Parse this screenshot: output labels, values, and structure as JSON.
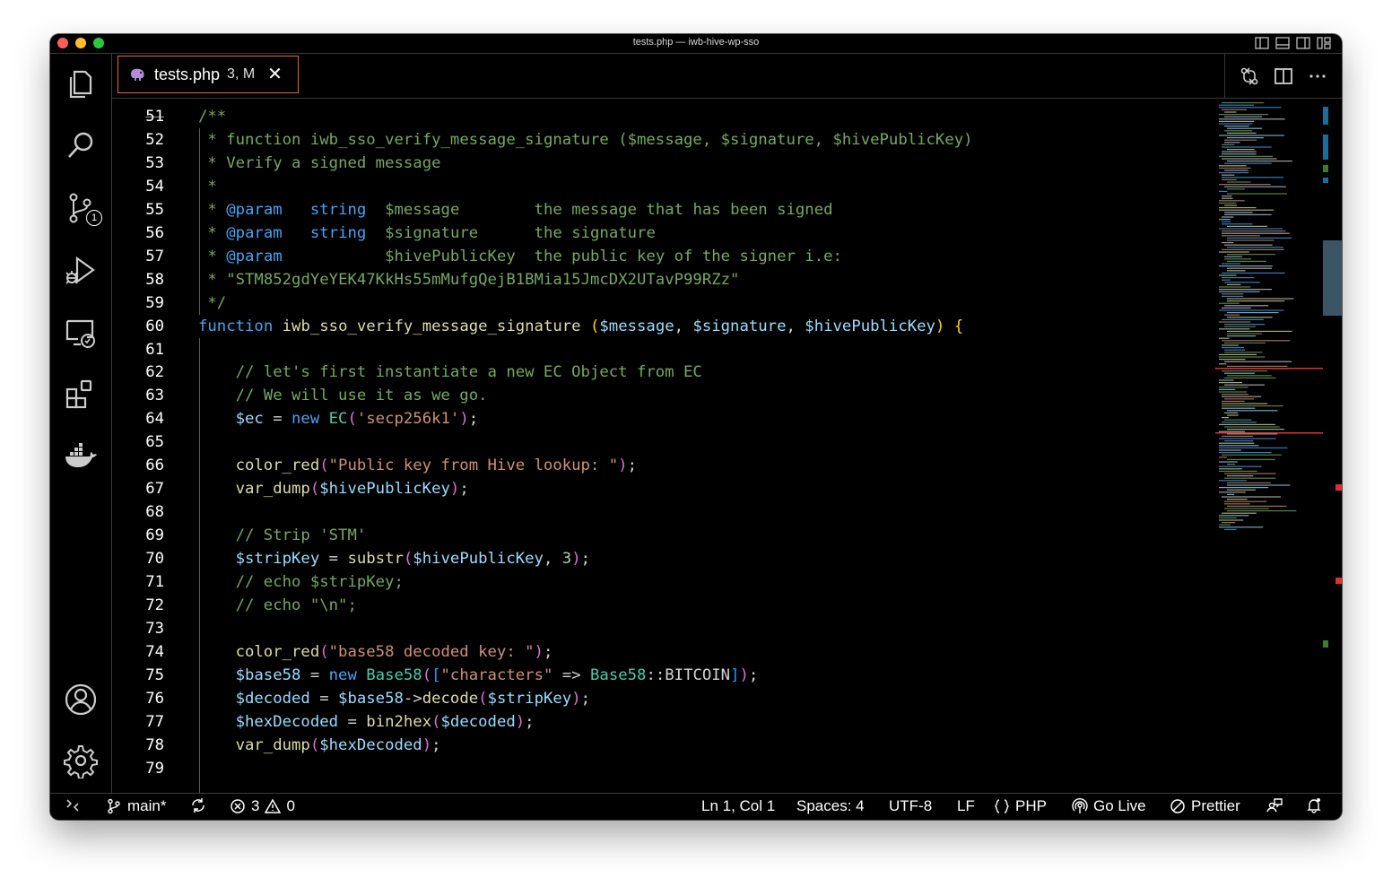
{
  "window": {
    "title": "tests.php — iwb-hive-wp-sso",
    "traffic_lights": [
      "#ff5f57",
      "#febc2e",
      "#28c840"
    ]
  },
  "activity_bar": {
    "items": [
      {
        "name": "explorer-icon"
      },
      {
        "name": "search-icon"
      },
      {
        "name": "source-control-icon",
        "badge": "1"
      },
      {
        "name": "run-debug-icon"
      },
      {
        "name": "remote-explorer-icon"
      },
      {
        "name": "extensions-icon"
      },
      {
        "name": "docker-icon"
      }
    ],
    "bottom": [
      {
        "name": "account-icon"
      },
      {
        "name": "settings-gear-icon"
      }
    ]
  },
  "tabs": [
    {
      "name": "tests.php",
      "status": "3, M",
      "active": true,
      "accent": "#e06c2e"
    }
  ],
  "editor": {
    "lines": [
      {
        "n": "51",
        "indent": 0,
        "parts": [
          [
            "c-comment",
            "/**"
          ]
        ]
      },
      {
        "n": "52",
        "indent": 0,
        "parts": [
          [
            "c-comment",
            " * function iwb_sso_verify_message_signature ($message, $signature, $hivePublicKey)"
          ]
        ]
      },
      {
        "n": "53",
        "indent": 0,
        "parts": [
          [
            "c-comment",
            " * Verify a signed message"
          ]
        ]
      },
      {
        "n": "54",
        "indent": 0,
        "parts": [
          [
            "c-comment",
            " *"
          ]
        ]
      },
      {
        "n": "55",
        "indent": 0,
        "parts": [
          [
            "c-comment",
            " * "
          ],
          [
            "c-tag",
            "@param"
          ],
          [
            "c-comment",
            "   "
          ],
          [
            "c-type",
            "string"
          ],
          [
            "c-comment",
            "  $message        the message that has been signed"
          ]
        ]
      },
      {
        "n": "56",
        "indent": 0,
        "parts": [
          [
            "c-comment",
            " * "
          ],
          [
            "c-tag",
            "@param"
          ],
          [
            "c-comment",
            "   "
          ],
          [
            "c-type",
            "string"
          ],
          [
            "c-comment",
            "  $signature      the signature"
          ]
        ]
      },
      {
        "n": "57",
        "indent": 0,
        "parts": [
          [
            "c-comment",
            " * "
          ],
          [
            "c-tag",
            "@param"
          ],
          [
            "c-comment",
            "           $hivePublicKey  the public key of the signer i.e:"
          ]
        ]
      },
      {
        "n": "58",
        "indent": 0,
        "parts": [
          [
            "c-comment",
            " * \"STM852gdYeYEK47KkHs55mMufgQejB1BMia15JmcDX2UTavP99RZz\""
          ]
        ]
      },
      {
        "n": "59",
        "indent": 0,
        "parts": [
          [
            "c-comment",
            " */"
          ]
        ]
      },
      {
        "n": "60",
        "indent": 0,
        "parts": [
          [
            "c-kw",
            "function"
          ],
          [
            "c-plain",
            " "
          ],
          [
            "c-fn",
            "iwb_sso_verify_message_signature"
          ],
          [
            "c-plain",
            " "
          ],
          [
            "c-p1",
            "("
          ],
          [
            "c-var",
            "$message"
          ],
          [
            "c-plain",
            ", "
          ],
          [
            "c-var",
            "$signature"
          ],
          [
            "c-plain",
            ", "
          ],
          [
            "c-var",
            "$hivePublicKey"
          ],
          [
            "c-p1",
            ")"
          ],
          [
            "c-plain",
            " "
          ],
          [
            "c-p1",
            "{"
          ]
        ]
      },
      {
        "n": "61",
        "indent": 0,
        "parts": []
      },
      {
        "n": "62",
        "indent": 1,
        "parts": [
          [
            "c-comment",
            "// let's first instantiate a new EC Object from EC"
          ]
        ]
      },
      {
        "n": "63",
        "indent": 1,
        "parts": [
          [
            "c-comment",
            "// We will use it as we go."
          ]
        ]
      },
      {
        "n": "64",
        "indent": 1,
        "parts": [
          [
            "c-var",
            "$ec"
          ],
          [
            "c-plain",
            " = "
          ],
          [
            "c-kw",
            "new"
          ],
          [
            "c-plain",
            " "
          ],
          [
            "c-cls",
            "EC"
          ],
          [
            "c-p2",
            "("
          ],
          [
            "c-str",
            "'secp256k1'"
          ],
          [
            "c-p2",
            ")"
          ],
          [
            "c-plain",
            ";"
          ]
        ]
      },
      {
        "n": "65",
        "indent": 1,
        "parts": []
      },
      {
        "n": "66",
        "indent": 1,
        "parts": [
          [
            "c-fn",
            "color_red"
          ],
          [
            "c-p2",
            "("
          ],
          [
            "c-str",
            "\"Public key from Hive lookup: \""
          ],
          [
            "c-p2",
            ")"
          ],
          [
            "c-plain",
            ";"
          ]
        ]
      },
      {
        "n": "67",
        "indent": 1,
        "parts": [
          [
            "c-fn",
            "var_dump"
          ],
          [
            "c-p2",
            "("
          ],
          [
            "c-var",
            "$hivePublicKey"
          ],
          [
            "c-p2",
            ")"
          ],
          [
            "c-plain",
            ";"
          ]
        ]
      },
      {
        "n": "68",
        "indent": 1,
        "parts": []
      },
      {
        "n": "69",
        "indent": 1,
        "parts": [
          [
            "c-comment",
            "// Strip 'STM'"
          ]
        ]
      },
      {
        "n": "70",
        "indent": 1,
        "parts": [
          [
            "c-var",
            "$stripKey"
          ],
          [
            "c-plain",
            " = "
          ],
          [
            "c-fn",
            "substr"
          ],
          [
            "c-p2",
            "("
          ],
          [
            "c-var",
            "$hivePublicKey"
          ],
          [
            "c-plain",
            ", "
          ],
          [
            "c-num",
            "3"
          ],
          [
            "c-p2",
            ")"
          ],
          [
            "c-plain",
            ";"
          ]
        ]
      },
      {
        "n": "71",
        "indent": 1,
        "parts": [
          [
            "c-comment",
            "// echo $stripKey;"
          ]
        ]
      },
      {
        "n": "72",
        "indent": 1,
        "parts": [
          [
            "c-comment",
            "// echo \"\\n\";"
          ]
        ]
      },
      {
        "n": "73",
        "indent": 1,
        "parts": []
      },
      {
        "n": "74",
        "indent": 1,
        "parts": [
          [
            "c-fn",
            "color_red"
          ],
          [
            "c-p2",
            "("
          ],
          [
            "c-str",
            "\"base58 decoded key: \""
          ],
          [
            "c-p2",
            ")"
          ],
          [
            "c-plain",
            ";"
          ]
        ]
      },
      {
        "n": "75",
        "indent": 1,
        "parts": [
          [
            "c-var",
            "$base58"
          ],
          [
            "c-plain",
            " = "
          ],
          [
            "c-kw",
            "new"
          ],
          [
            "c-plain",
            " "
          ],
          [
            "c-cls",
            "Base58"
          ],
          [
            "c-p2",
            "("
          ],
          [
            "c-p3",
            "["
          ],
          [
            "c-str",
            "\"characters\""
          ],
          [
            "c-plain",
            " => "
          ],
          [
            "c-cls",
            "Base58"
          ],
          [
            "c-plain",
            "::BITCOIN"
          ],
          [
            "c-p3",
            "]"
          ],
          [
            "c-p2",
            ")"
          ],
          [
            "c-plain",
            ";"
          ]
        ]
      },
      {
        "n": "76",
        "indent": 1,
        "parts": [
          [
            "c-var",
            "$decoded"
          ],
          [
            "c-plain",
            " = "
          ],
          [
            "c-var",
            "$base58"
          ],
          [
            "c-plain",
            "->"
          ],
          [
            "c-fn",
            "decode"
          ],
          [
            "c-p2",
            "("
          ],
          [
            "c-var",
            "$stripKey"
          ],
          [
            "c-p2",
            ")"
          ],
          [
            "c-plain",
            ";"
          ]
        ]
      },
      {
        "n": "77",
        "indent": 1,
        "parts": [
          [
            "c-var",
            "$hexDecoded"
          ],
          [
            "c-plain",
            " = "
          ],
          [
            "c-fn",
            "bin2hex"
          ],
          [
            "c-p2",
            "("
          ],
          [
            "c-var",
            "$decoded"
          ],
          [
            "c-p2",
            ")"
          ],
          [
            "c-plain",
            ";"
          ]
        ]
      },
      {
        "n": "78",
        "indent": 1,
        "parts": [
          [
            "c-fn",
            "var_dump"
          ],
          [
            "c-p2",
            "("
          ],
          [
            "c-var",
            "$hexDecoded"
          ],
          [
            "c-p2",
            ")"
          ],
          [
            "c-plain",
            ";"
          ]
        ]
      },
      {
        "n": "79",
        "indent": 1,
        "parts": []
      }
    ]
  },
  "status_bar": {
    "branch": "main*",
    "errors": "3",
    "warnings": "0",
    "cursor": "Ln 1, Col 1",
    "spaces": "Spaces: 4",
    "encoding": "UTF-8",
    "eol": "LF",
    "language": "PHP",
    "go_live": "Go Live",
    "prettier": "Prettier"
  }
}
